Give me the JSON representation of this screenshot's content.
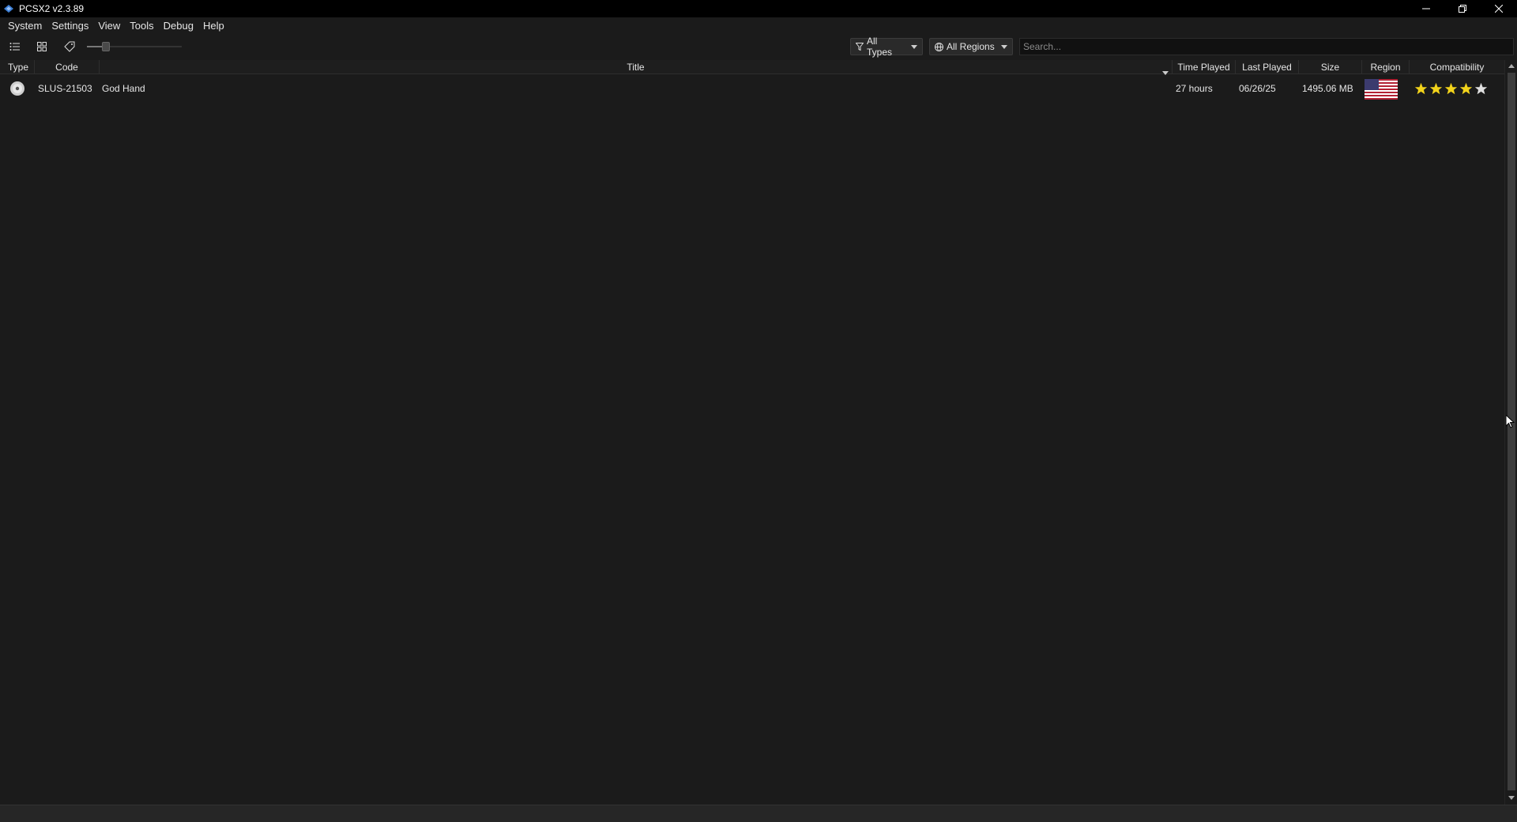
{
  "window": {
    "title": "PCSX2 v2.3.89"
  },
  "menu": {
    "items": [
      {
        "label": "System"
      },
      {
        "label": "Settings"
      },
      {
        "label": "View"
      },
      {
        "label": "Tools"
      },
      {
        "label": "Debug"
      },
      {
        "label": "Help"
      }
    ]
  },
  "toolbar": {
    "zoom_level": 0.2,
    "type_filter": "All Types",
    "region_filter": "All Regions",
    "search_placeholder": "Search..."
  },
  "table": {
    "columns": [
      "Type",
      "Code",
      "Title",
      "Time Played",
      "Last Played",
      "Size",
      "Region",
      "Compatibility"
    ],
    "rows": [
      {
        "type_icon": "disc-icon",
        "code": "SLUS-21503",
        "title": "God Hand",
        "time_played": "27 hours",
        "last_played": "06/26/25",
        "size": "1495.06 MB",
        "region_icon": "us-flag-icon",
        "compatibility_stars": 5
      }
    ]
  },
  "colors": {
    "background": "#1b1b1b",
    "titlebar": "#000000",
    "star": "#f2d31b"
  }
}
